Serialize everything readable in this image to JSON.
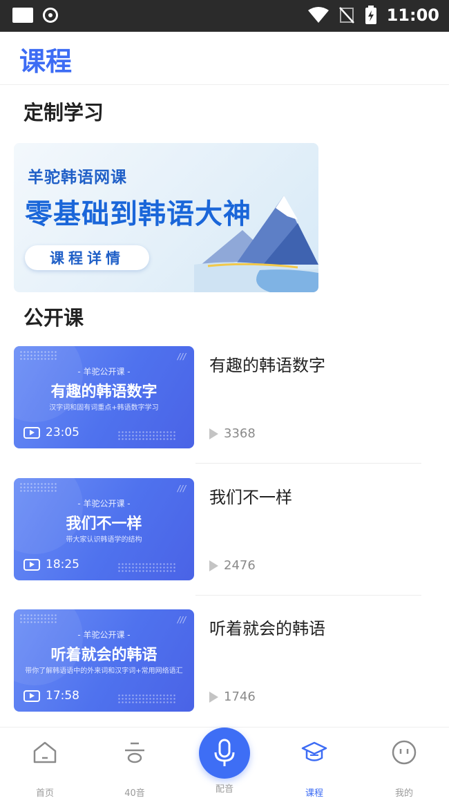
{
  "status_bar": {
    "time": "11:00"
  },
  "header": {
    "title": "课程"
  },
  "sections": {
    "custom": "定制学习",
    "public": "公开课"
  },
  "banner": {
    "subtitle": "羊驼韩语网课",
    "headline": "零基础到韩语大神",
    "button": "课程详情"
  },
  "courses": [
    {
      "tag": "- 羊驼公开课 -",
      "thumb_title": "有趣的韩语数字",
      "thumb_desc": "汉字词和固有词重点+韩语数字学习",
      "duration": "23:05",
      "title": "有趣的韩语数字",
      "views": "3368"
    },
    {
      "tag": "- 羊驼公开课 -",
      "thumb_title": "我们不一样",
      "thumb_desc": "带大家认识韩语学的结构",
      "duration": "18:25",
      "title": "我们不一样",
      "views": "2476"
    },
    {
      "tag": "- 羊驼公开课 -",
      "thumb_title": "听着就会的韩语",
      "thumb_desc": "带你了解韩语语中的外来词和汉字词+常用网络语汇",
      "duration": "17:58",
      "title": "听着就会的韩语",
      "views": "1746"
    }
  ],
  "nav": {
    "home": "首页",
    "sounds": "40音",
    "dub": "配音",
    "courses": "课程",
    "mine": "我的"
  },
  "colors": {
    "accent": "#3d6cf4",
    "thumb": "#5577ee"
  }
}
